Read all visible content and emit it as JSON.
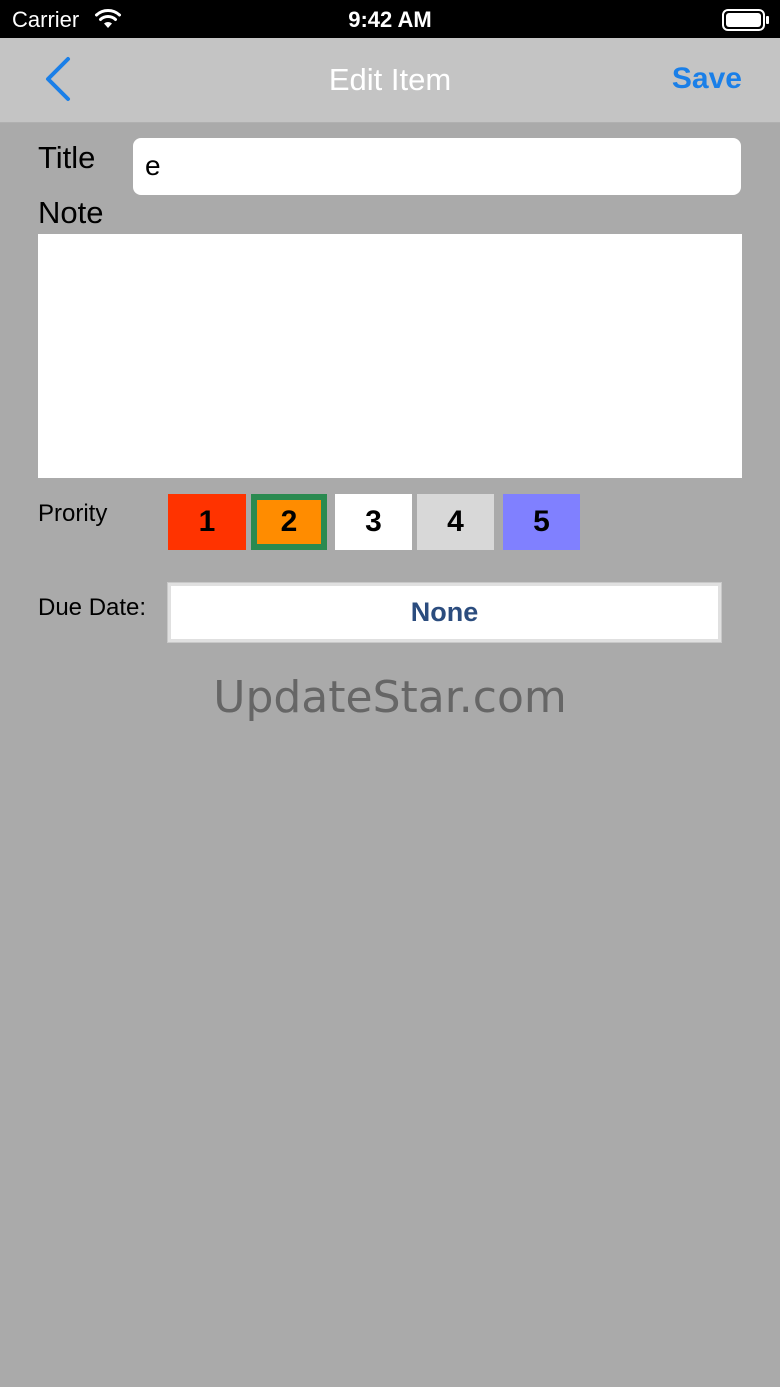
{
  "status_bar": {
    "carrier": "Carrier",
    "time": "9:42 AM"
  },
  "nav": {
    "title": "Edit Item",
    "save_label": "Save",
    "accent_color": "#1a7fe8"
  },
  "form": {
    "title_label": "Title",
    "title_value": "e",
    "note_label": "Note",
    "note_value": "",
    "priority_label": "Prority",
    "priorities": [
      {
        "label": "1",
        "color": "#ff3300"
      },
      {
        "label": "2",
        "color": "#ff8c00",
        "selected": true
      },
      {
        "label": "3",
        "color": "#ffffff"
      },
      {
        "label": "4",
        "color": "#d8d8d8"
      },
      {
        "label": "5",
        "color": "#8080ff"
      }
    ],
    "due_label": "Due Date:",
    "due_value": "None"
  },
  "watermark": "UpdateStar.com"
}
